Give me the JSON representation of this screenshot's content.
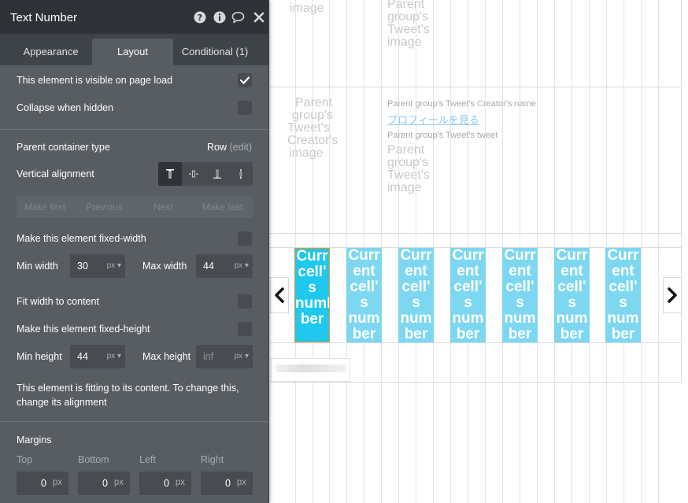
{
  "panel": {
    "title": "Text Number",
    "tabs": [
      "Appearance",
      "Layout",
      "Conditional (1)"
    ],
    "active_tab": "Layout",
    "visible_on_load": {
      "label": "This element is visible on page load",
      "checked": true
    },
    "collapse_when_hidden": {
      "label": "Collapse when hidden",
      "checked": false
    },
    "parent_container": {
      "label": "Parent container type",
      "value": "Row",
      "edit": "(edit)"
    },
    "vertical_alignment": {
      "label": "Vertical alignment",
      "options": [
        "top",
        "center",
        "bottom",
        "stretch"
      ],
      "selected": "top"
    },
    "nav": [
      "Make first",
      "Previous",
      "Next",
      "Make last"
    ],
    "fixed_width": {
      "label": "Make this element fixed-width",
      "checked": false
    },
    "min_width": {
      "label": "Min width",
      "value": "30",
      "unit": "px"
    },
    "max_width": {
      "label": "Max width",
      "value": "44",
      "unit": "px"
    },
    "fit_width": {
      "label": "Fit width to content",
      "checked": false
    },
    "fixed_height": {
      "label": "Make this element fixed-height",
      "checked": false
    },
    "min_height": {
      "label": "Min height",
      "value": "44",
      "unit": "px"
    },
    "max_height": {
      "label": "Max height",
      "placeholder": "inf",
      "unit": "px"
    },
    "fitting_note_line1": "This element is fitting to its content. To change this,",
    "fitting_note_line2": "change its alignment",
    "margins": {
      "label": "Margins",
      "top": {
        "label": "Top",
        "value": "0",
        "unit": "px"
      },
      "bottom": {
        "label": "Bottom",
        "value": "0",
        "unit": "px"
      },
      "left": {
        "label": "Left",
        "value": "0",
        "unit": "px"
      },
      "right": {
        "label": "Right",
        "value": "0",
        "unit": "px"
      }
    }
  },
  "canvas": {
    "ghost_image_top_left": "image",
    "ghost_parent_image_1": [
      "Parent",
      "group's",
      "Tweet's",
      "image"
    ],
    "ghost_creator_image": [
      "Parent",
      "group's",
      "Tweet's",
      "Creator's",
      "image"
    ],
    "creator_name": "Parent group's Tweet's Creator's name",
    "profile_link": "プロフィールを見る",
    "tweet_text": "Parent group's Tweet's tweet",
    "ghost_parent_image_2": [
      "Parent",
      "group's",
      "Tweet's",
      "image"
    ],
    "cells": [
      [
        "Curr",
        "cell'",
        "s",
        "numb",
        "ber"
      ],
      [
        "Curr",
        "ent",
        "cell'",
        "s",
        "num",
        "ber"
      ],
      [
        "Curr",
        "ent",
        "cell'",
        "s",
        "num",
        "ber"
      ],
      [
        "Curr",
        "ent",
        "cell'",
        "s",
        "num",
        "ber"
      ],
      [
        "Curr",
        "ent",
        "cell'",
        "s",
        "num",
        "ber"
      ],
      [
        "Curr",
        "ent",
        "cell'",
        "s",
        "num",
        "ber"
      ],
      [
        "Curr",
        "ent",
        "cell'",
        "s",
        "num",
        "ber"
      ]
    ]
  },
  "colors": {
    "panel_bg": "#575d61",
    "titlebar_bg": "#2f3337",
    "cell_bg": "#7dd7f0",
    "cell_selected": "#1ec8ef",
    "selection_border": "#f0921e"
  }
}
